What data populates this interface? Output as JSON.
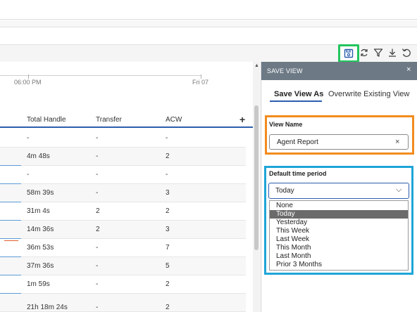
{
  "toolbar": {
    "icons": [
      "save-icon",
      "refresh-icon",
      "filter-icon",
      "download-icon",
      "undo-icon"
    ],
    "accent": "#22c55e"
  },
  "timeline": {
    "labels": [
      "06:00 PM",
      "Fri 07"
    ]
  },
  "table": {
    "columns": [
      "Total Handle",
      "Transfer",
      "ACW"
    ],
    "rows": [
      {
        "total_handle": "-",
        "transfer": "-",
        "acw": "-"
      },
      {
        "total_handle": "4m 48s",
        "transfer": "-",
        "acw": "2"
      },
      {
        "total_handle": "-",
        "transfer": "-",
        "acw": "-"
      },
      {
        "total_handle": "58m 39s",
        "transfer": "-",
        "acw": "3"
      },
      {
        "total_handle": "31m 4s",
        "transfer": "2",
        "acw": "2"
      },
      {
        "total_handle": "14m 36s",
        "transfer": "2",
        "acw": "3"
      },
      {
        "total_handle": "36m 53s",
        "transfer": "-",
        "acw": "7"
      },
      {
        "total_handle": "37m 36s",
        "transfer": "-",
        "acw": "5"
      },
      {
        "total_handle": "1m 59s",
        "transfer": "-",
        "acw": "2"
      },
      {
        "total_handle": "21h 18m 24s",
        "transfer": "-",
        "acw": "2"
      }
    ],
    "add_column": "+"
  },
  "panel": {
    "title": "SAVE VIEW",
    "close": "×",
    "tabs": [
      "Save View As",
      "Overwrite Existing View"
    ],
    "view_name_label": "View Name",
    "view_name_value": "Agent Report",
    "clear": "×",
    "time_period_label": "Default time period",
    "time_period_value": "Today",
    "chevron": "⌵",
    "options": [
      "None",
      "Today",
      "Yesterday",
      "This Week",
      "Last Week",
      "This Month",
      "Last Month",
      "Prior 3 Months"
    ],
    "selected_option": "Today"
  },
  "colors": {
    "header_blue": "#2b5fad",
    "panel_header": "#6d7a86",
    "orange_highlight": "#f28c1e",
    "blue_highlight": "#1fa5d8"
  }
}
